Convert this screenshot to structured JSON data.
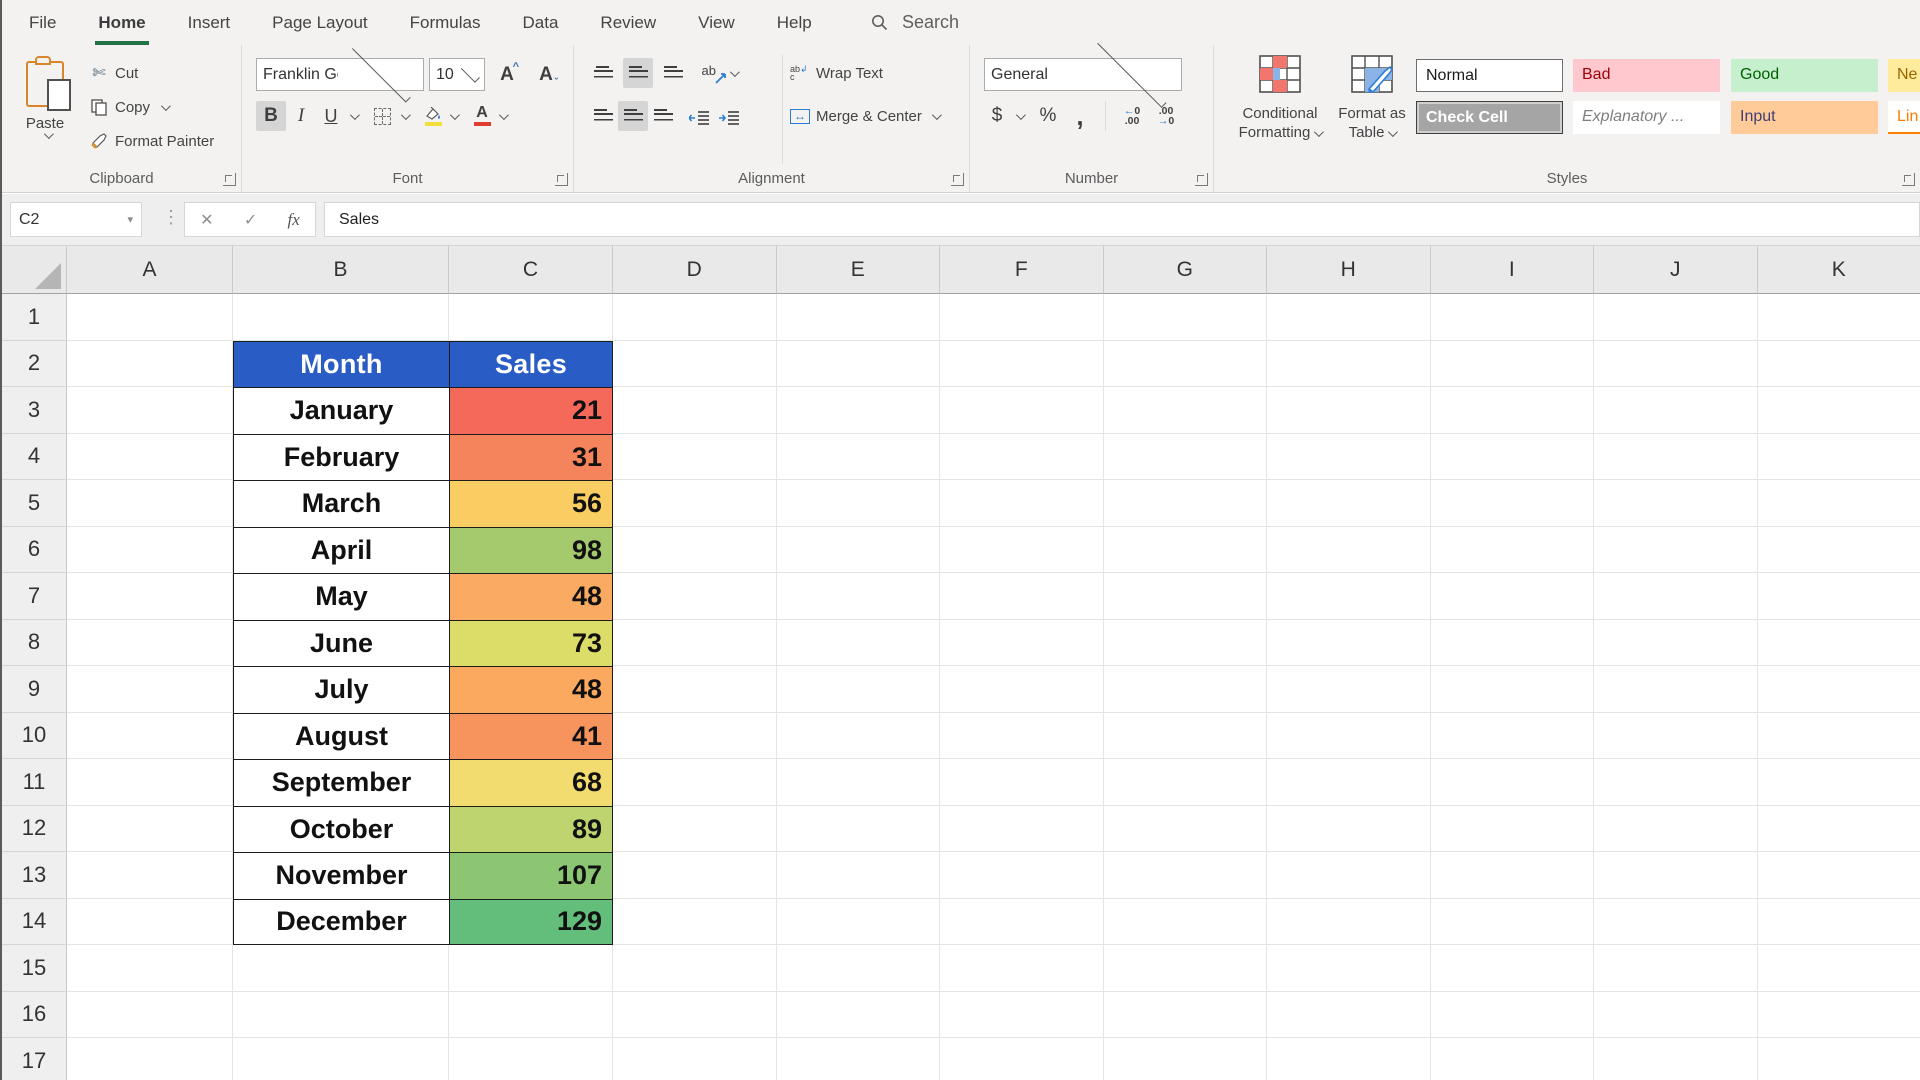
{
  "menubar": {
    "tabs": [
      "File",
      "Home",
      "Insert",
      "Page Layout",
      "Formulas",
      "Data",
      "Review",
      "View",
      "Help"
    ],
    "active_tab": "Home",
    "search_label": "Search"
  },
  "ribbon": {
    "clipboard": {
      "group_label": "Clipboard",
      "paste_label": "Paste",
      "cut_label": "Cut",
      "copy_label": "Copy",
      "format_painter_label": "Format Painter"
    },
    "font": {
      "group_label": "Font",
      "font_name": "Franklin Gothic Me",
      "font_size": "10",
      "bold_label": "B",
      "italic_label": "I",
      "underline_label": "U"
    },
    "alignment": {
      "group_label": "Alignment",
      "wrap_text_label": "Wrap Text",
      "merge_center_label": "Merge & Center"
    },
    "number": {
      "group_label": "Number",
      "number_format": "General",
      "currency_label": "$",
      "percent_label": "%",
      "comma_label": ","
    },
    "styles": {
      "group_label": "Styles",
      "conditional_formatting_line1": "Conditional",
      "conditional_formatting_line2": "Formatting",
      "format_as_table_line1": "Format as",
      "format_as_table_line2": "Table",
      "cell_styles": [
        {
          "label": "Normal",
          "css": "background:#ffffff;color:#1a1a1a;border:1.6px solid #6e6e6e"
        },
        {
          "label": "Bad",
          "css": "background:#FFC7CE;color:#9C0006"
        },
        {
          "label": "Good",
          "css": "background:#C6EFCE;color:#006100"
        },
        {
          "label": "Ne",
          "css": "background:#FFEB9C;color:#9C6500"
        },
        {
          "label": "Check Cell",
          "css": "background:#A5A5A5;color:#ffffff;font-weight:700;border:1px solid #3f3f3f;box-shadow:inset 0 0 0 2px #cfcfcf"
        },
        {
          "label": "Explanatory ...",
          "css": "background:#ffffff;color:#7F7F7F;font-style:italic"
        },
        {
          "label": "Input",
          "css": "background:#FFCC99;color:#3F3F76"
        },
        {
          "label": "Lin",
          "css": "background:#ffffff;color:#FA7D00;border-bottom:2.5px solid #FF8001"
        }
      ]
    }
  },
  "formula_bar": {
    "name_box_value": "C2",
    "formula_value": "Sales"
  },
  "sheet": {
    "column_letters": [
      "A",
      "B",
      "C",
      "D",
      "E",
      "F",
      "G",
      "H",
      "I",
      "J",
      "K"
    ],
    "visible_rows": 17,
    "table": {
      "start_cell": "B2",
      "columns": [
        "Month",
        "Sales"
      ],
      "header_bg": "#2A5CC6",
      "header_fg": "#ffffff",
      "rows": [
        {
          "month": "January",
          "sales": "21",
          "sales_bg": "#F5695B"
        },
        {
          "month": "February",
          "sales": "31",
          "sales_bg": "#F5845C"
        },
        {
          "month": "March",
          "sales": "56",
          "sales_bg": "#FACD63"
        },
        {
          "month": "April",
          "sales": "98",
          "sales_bg": "#A5CA6E"
        },
        {
          "month": "May",
          "sales": "48",
          "sales_bg": "#FAAB61"
        },
        {
          "month": "June",
          "sales": "73",
          "sales_bg": "#DCDC69"
        },
        {
          "month": "July",
          "sales": "48",
          "sales_bg": "#FAA95F"
        },
        {
          "month": "August",
          "sales": "41",
          "sales_bg": "#F7945E"
        },
        {
          "month": "September",
          "sales": "68",
          "sales_bg": "#F3DC6F"
        },
        {
          "month": "October",
          "sales": "89",
          "sales_bg": "#BDD46F"
        },
        {
          "month": "November",
          "sales": "107",
          "sales_bg": "#8CC673"
        },
        {
          "month": "December",
          "sales": "129",
          "sales_bg": "#63BE7B"
        }
      ]
    }
  },
  "colors": {
    "accent_green": "#217346",
    "fill_yellow": "#F3DE3A",
    "font_color_red": "#E03C32",
    "ribbon_bg": "#f3f2f1"
  }
}
